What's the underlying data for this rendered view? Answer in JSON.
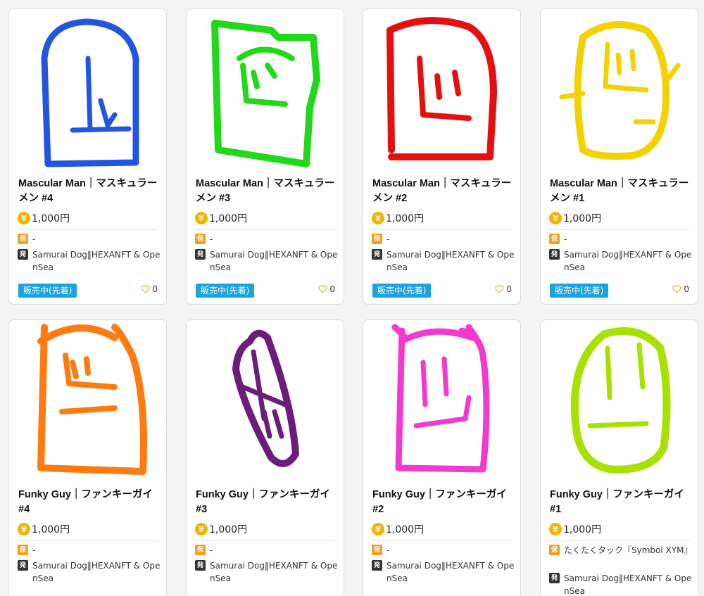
{
  "cards": [
    {
      "title": "Mascular Man｜マスキュラーメン #4",
      "price": "1,000円",
      "holder": "-",
      "issuer": "Samurai Dog‖HEXANFT & OpenSea",
      "status": "販売中(先着)",
      "likes": "0",
      "color": "#2255e0"
    },
    {
      "title": "Mascular Man｜マスキュラーメン #3",
      "price": "1,000円",
      "holder": "-",
      "issuer": "Samurai Dog‖HEXANFT & OpenSea",
      "status": "販売中(先着)",
      "likes": "0",
      "color": "#22d81a"
    },
    {
      "title": "Mascular Man｜マスキュラーメン #2",
      "price": "1,000円",
      "holder": "-",
      "issuer": "Samurai Dog‖HEXANFT & OpenSea",
      "status": "販売中(先着)",
      "likes": "0",
      "color": "#e41010"
    },
    {
      "title": "Mascular Man｜マスキュラーメン #1",
      "price": "1,000円",
      "holder": "-",
      "issuer": "Samurai Dog‖HEXANFT & OpenSea",
      "status": "販売中(先着)",
      "likes": "0",
      "color": "#f2d200"
    },
    {
      "title": "Funky Guy｜ファンキーガイ #4",
      "price": "1,000円",
      "holder": "-",
      "issuer": "Samurai Dog‖HEXANFT & OpenSea",
      "color": "#ff7a10"
    },
    {
      "title": "Funky Guy｜ファンキーガイ #3",
      "price": "1,000円",
      "holder": "-",
      "issuer": "Samurai Dog‖HEXANFT & OpenSea",
      "color": "#6a1e7a"
    },
    {
      "title": "Funky Guy｜ファンキーガイ #2",
      "price": "1,000円",
      "holder": "-",
      "issuer": "Samurai Dog‖HEXANFT & OpenSea",
      "color": "#f23ad0"
    },
    {
      "title": "Funky Guy｜ファンキーガイ #1",
      "price": "1,000円",
      "holder": "たくたくタック『Symbol XYM』",
      "issuer": "Samurai Dog‖HEXANFT & OpenSea",
      "color": "#a8e000"
    }
  ],
  "labels": {
    "yen_symbol": "¥",
    "hold_tag": "保",
    "issue_tag": "発"
  }
}
